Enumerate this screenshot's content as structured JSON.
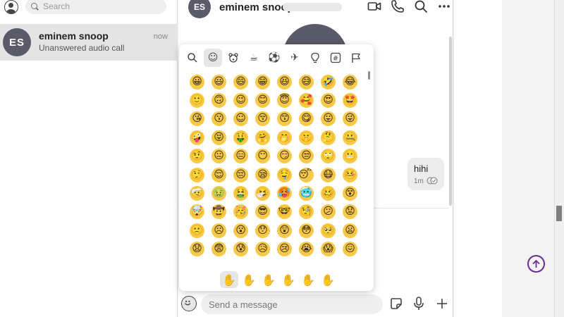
{
  "sidebar": {
    "search_placeholder": "Search",
    "chats": [
      {
        "initials": "ES",
        "name": "eminem snoop",
        "time": "now",
        "preview": "Unanswered audio call"
      }
    ]
  },
  "conversation": {
    "header_initials": "ES",
    "header_name": "eminem snoop",
    "icons": [
      "video-call-icon",
      "audio-call-icon",
      "search-icon",
      "more-icon"
    ],
    "message": {
      "text": "hihi",
      "time": "1m",
      "status_icon": "read-receipt-icon"
    },
    "composer_placeholder": "Send a message"
  },
  "emoji_picker": {
    "categories": [
      {
        "name": "search",
        "glyph": ""
      },
      {
        "name": "smileys",
        "glyph": "☺",
        "active": true
      },
      {
        "name": "animals",
        "glyph": ""
      },
      {
        "name": "food",
        "glyph": "☕"
      },
      {
        "name": "activity",
        "glyph": "⚽"
      },
      {
        "name": "travel",
        "glyph": "✈"
      },
      {
        "name": "objects",
        "glyph": ""
      },
      {
        "name": "symbols",
        "glyph": "#"
      },
      {
        "name": "flags",
        "glyph": ""
      }
    ],
    "rows": [
      [
        "😀",
        "😃",
        "😄",
        "😁",
        "😆",
        "😅",
        "🤣",
        "😂"
      ],
      [
        "🙂",
        "🙃",
        "😉",
        "😊",
        "😇",
        "🥰",
        "😍",
        "🤩"
      ],
      [
        "😘",
        "😗",
        "☺",
        "😚",
        "😙",
        "😋",
        "😛",
        "😜"
      ],
      [
        "🤪",
        "😝",
        "🤑",
        "🤗",
        "🤭",
        "🤫",
        "🤔",
        "🤐"
      ],
      [
        "🤨",
        "😐",
        "😑",
        "😶",
        "😏",
        "😒",
        "🙄",
        "😬"
      ],
      [
        "🤥",
        "😌",
        "😔",
        "😪",
        "🤤",
        "😴",
        "😷",
        "🤒"
      ],
      [
        "🤕",
        "🤢",
        "🤮",
        "🤧",
        "🥵",
        "🥶",
        "🥴",
        "😵"
      ],
      [
        "🤯",
        "🤠",
        "🥳",
        "😎",
        "🤓",
        "🧐",
        "😕",
        "😟"
      ],
      [
        "🙁",
        "☹",
        "😮",
        "😯",
        "😲",
        "😳",
        "🥺",
        "😦"
      ],
      [
        "😧",
        "😨",
        "😰",
        "😥",
        "😢",
        "😭",
        "😱",
        "😖"
      ]
    ],
    "skin_tones": [
      {
        "glyph": "✋",
        "color": "#f7c948",
        "active": true
      },
      {
        "glyph": "✋",
        "color": "#f3d6c4"
      },
      {
        "glyph": "✋",
        "color": "#d9b08c"
      },
      {
        "glyph": "✋",
        "color": "#b27b55"
      },
      {
        "glyph": "✋",
        "color": "#7b4a2c"
      },
      {
        "glyph": "✋",
        "color": "#3f2a1e"
      }
    ]
  },
  "colors": {
    "emoji_yellow": "#f7c948",
    "avatar_bg": "#5a5a68",
    "accent_purple": "#6a2c91"
  }
}
